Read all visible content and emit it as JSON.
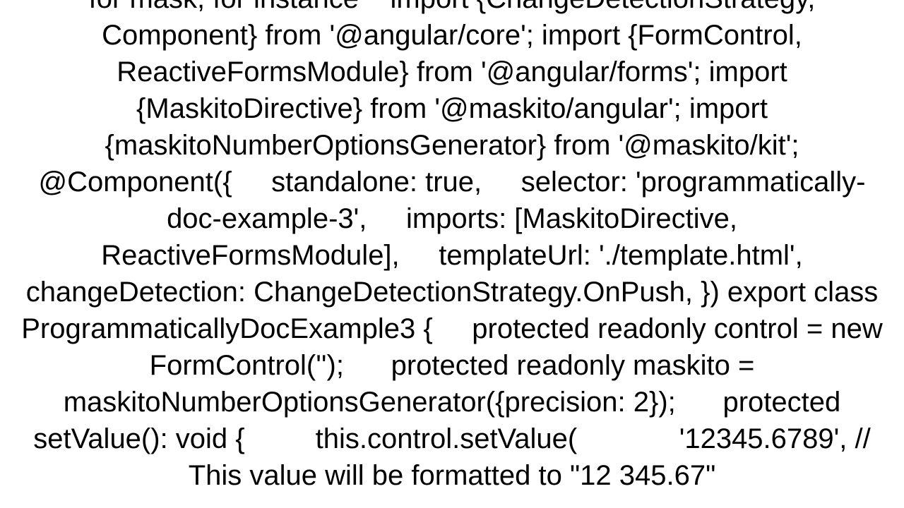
{
  "document": {
    "body": "for mask, for instance    import {ChangeDetectionStrategy, Component} from '@angular/core'; import {FormControl, ReactiveFormsModule} from '@angular/forms'; import {MaskitoDirective} from '@maskito/angular'; import {maskitoNumberOptionsGenerator} from '@maskito/kit';  @Component({     standalone: true,     selector: 'programmatically-doc-example-3',     imports: [MaskitoDirective, ReactiveFormsModule],     templateUrl: './template.html',     changeDetection: ChangeDetectionStrategy.OnPush, }) export class ProgrammaticallyDocExample3 {     protected readonly control = new FormControl('');      protected readonly maskito = maskitoNumberOptionsGenerator({precision: 2});      protected setValue(): void {         this.control.setValue(             '12345.6789', // This value will be formatted to \"12 345.67\""
  }
}
